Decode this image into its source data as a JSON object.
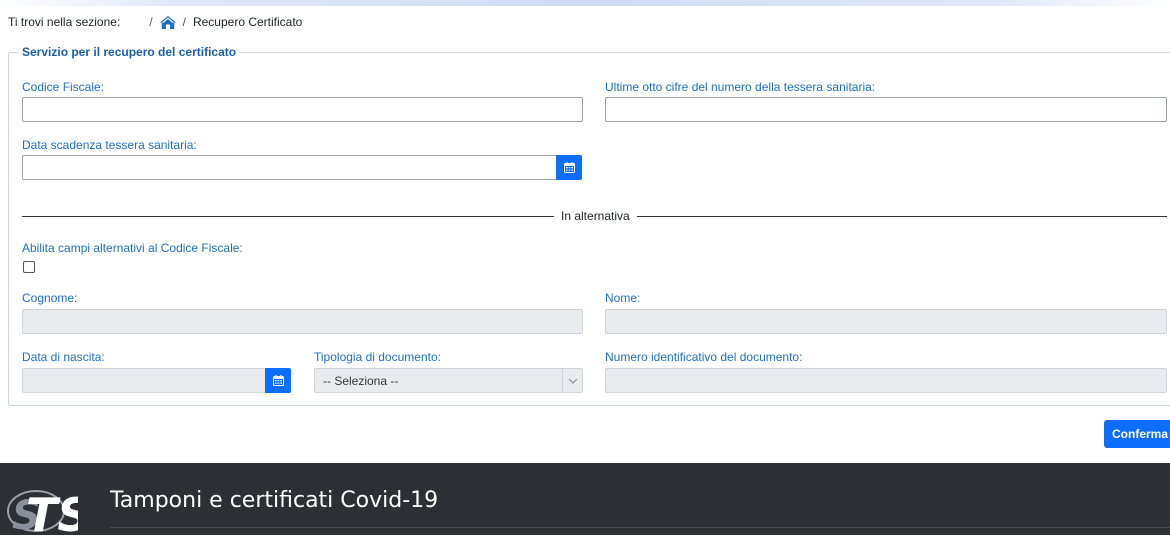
{
  "breadcrumb": {
    "section_label": "Ti trovi nella sezione:",
    "separator": "/",
    "current": "Recupero Certificato"
  },
  "panel": {
    "legend": "Servizio per il recupero del certificato",
    "codice_fiscale": {
      "label": "Codice Fiscale:",
      "value": ""
    },
    "tessera_cifre": {
      "label": "Ultime otto cifre del numero della tessera sanitaria:",
      "value": ""
    },
    "data_scadenza": {
      "label": "Data scadenza tessera sanitaria:",
      "value": ""
    },
    "divider_text": "In alternativa",
    "alt_enable": {
      "label": "Abilita campi alternativi al Codice Fiscale:",
      "checked": false
    },
    "cognome": {
      "label": "Cognome:",
      "value": ""
    },
    "nome": {
      "label": "Nome:",
      "value": ""
    },
    "data_nascita": {
      "label": "Data di nascita:",
      "value": ""
    },
    "tipologia": {
      "label": "Tipologia di documento:",
      "selected": "-- Seleziona --"
    },
    "numero_doc": {
      "label": "Numero identificativo del documento:",
      "value": ""
    }
  },
  "actions": {
    "confirm_label": "Conferma"
  },
  "footer": {
    "title": "Tamponi e certificati Covid-19",
    "logo_text": "TS"
  },
  "icons": {
    "home": "home-icon",
    "calendar": "calendar-icon",
    "dropdown": "chevron-down-icon"
  },
  "colors": {
    "accent": "#0d6efd",
    "label": "#1f6fc1",
    "footer_bg": "#2c2f33"
  }
}
